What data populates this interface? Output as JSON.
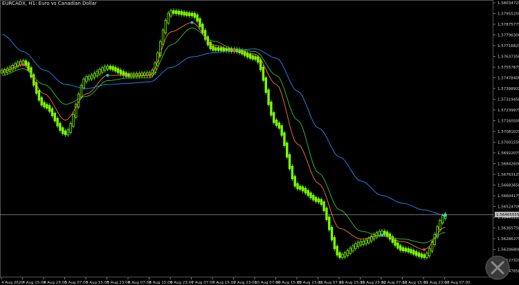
{
  "window": {
    "title": "EURCADX, H1: Euro vs Canadian Dollar"
  },
  "colors": {
    "background": "#000000",
    "candle": "#7CFC00",
    "ma_fast": "#FF7F27",
    "ma_mid": "#32CD32",
    "ma_slow": "#1E90FF",
    "axis": "#C8C8C8",
    "current_price_line": "#BDBDBD",
    "current_price_label_bg": "#C0C0C0"
  },
  "price_axis": {
    "labels": [
      "1.58034725",
      "1.57955250",
      "1.57875775",
      "1.57796300",
      "1.57716825",
      "1.57637350",
      "1.57557875",
      "1.57478400",
      "1.57398925",
      "1.57319450",
      "1.57239975",
      "1.57160500",
      "1.57081025",
      "1.57001550",
      "1.56922075",
      "1.56842600",
      "1.56763125",
      "1.56683650",
      "1.56604175",
      "1.56524700",
      "1.56445225",
      "1.56365750",
      "1.56286275",
      "1.56206800",
      "1.56127325",
      "1.56047850"
    ],
    "current_price": "1.56465555"
  },
  "time_axis": {
    "labels": [
      "4 Aug 2020",
      "4 Aug 15:00",
      "4 Aug 23:00",
      "5 Aug 07:00",
      "5 Aug 15:00",
      "5 Aug 23:00",
      "6 Aug 07:00",
      "6 Aug 15:00",
      "6 Aug 23:00",
      "7 Aug 07:00",
      "7 Aug 15:00",
      "7 Aug 23:00",
      "10 Aug 07:00",
      "10 Aug 15:00",
      "10 Aug 23:00",
      "11 Aug 07:00",
      "11 Aug 15:00",
      "11 Aug 23:00",
      "12 Aug 07:00",
      "12 Aug 15:00",
      "12 Aug 23:00",
      "13 Aug 07:00"
    ]
  },
  "chart_data": {
    "type": "line",
    "title": "EURCADX, H1: Euro vs Canadian Dollar",
    "y_range": [
      1.56,
      1.5808
    ],
    "x": [
      "4 Aug 2020",
      "4 Aug 15:00",
      "4 Aug 23:00",
      "5 Aug 07:00",
      "5 Aug 15:00",
      "5 Aug 23:00",
      "6 Aug 07:00",
      "6 Aug 15:00",
      "6 Aug 23:00",
      "7 Aug 07:00",
      "7 Aug 15:00",
      "7 Aug 23:00",
      "10 Aug 07:00",
      "10 Aug 15:00",
      "10 Aug 23:00",
      "11 Aug 07:00",
      "11 Aug 15:00",
      "11 Aug 23:00",
      "12 Aug 07:00",
      "12 Aug 15:00",
      "12 Aug 23:00",
      "13 Aug 07:00"
    ],
    "series": [
      {
        "values": [
          1.5755,
          1.5762,
          1.5729,
          1.5708,
          1.575,
          1.5758,
          1.5752,
          1.5753,
          1.58,
          1.5798,
          1.5772,
          1.5771,
          1.5765,
          1.5715,
          1.5667,
          1.5657,
          1.5615,
          1.5625,
          1.5633,
          1.562,
          1.5615,
          1.5646
        ]
      },
      {
        "values": [
          1.5755,
          1.576,
          1.5738,
          1.5718,
          1.5738,
          1.5752,
          1.5752,
          1.5752,
          1.5785,
          1.5792,
          1.5775,
          1.5771,
          1.5768,
          1.5745,
          1.57,
          1.567,
          1.5636,
          1.5628,
          1.5631,
          1.5626,
          1.562,
          1.5637
        ]
      },
      {
        "values": [
          1.5752,
          1.5757,
          1.5745,
          1.573,
          1.5736,
          1.5748,
          1.575,
          1.575,
          1.5775,
          1.5788,
          1.5778,
          1.5772,
          1.577,
          1.5752,
          1.5718,
          1.5678,
          1.565,
          1.5634,
          1.563,
          1.5628,
          1.5625,
          1.5633
        ]
      },
      {
        "values": [
          1.5783,
          1.577,
          1.5756,
          1.5745,
          1.5742,
          1.5745,
          1.5746,
          1.5747,
          1.5758,
          1.5766,
          1.5769,
          1.5771,
          1.5772,
          1.5765,
          1.574,
          1.5712,
          1.569,
          1.5672,
          1.5661,
          1.5655,
          1.565,
          1.5646
        ]
      }
    ]
  }
}
